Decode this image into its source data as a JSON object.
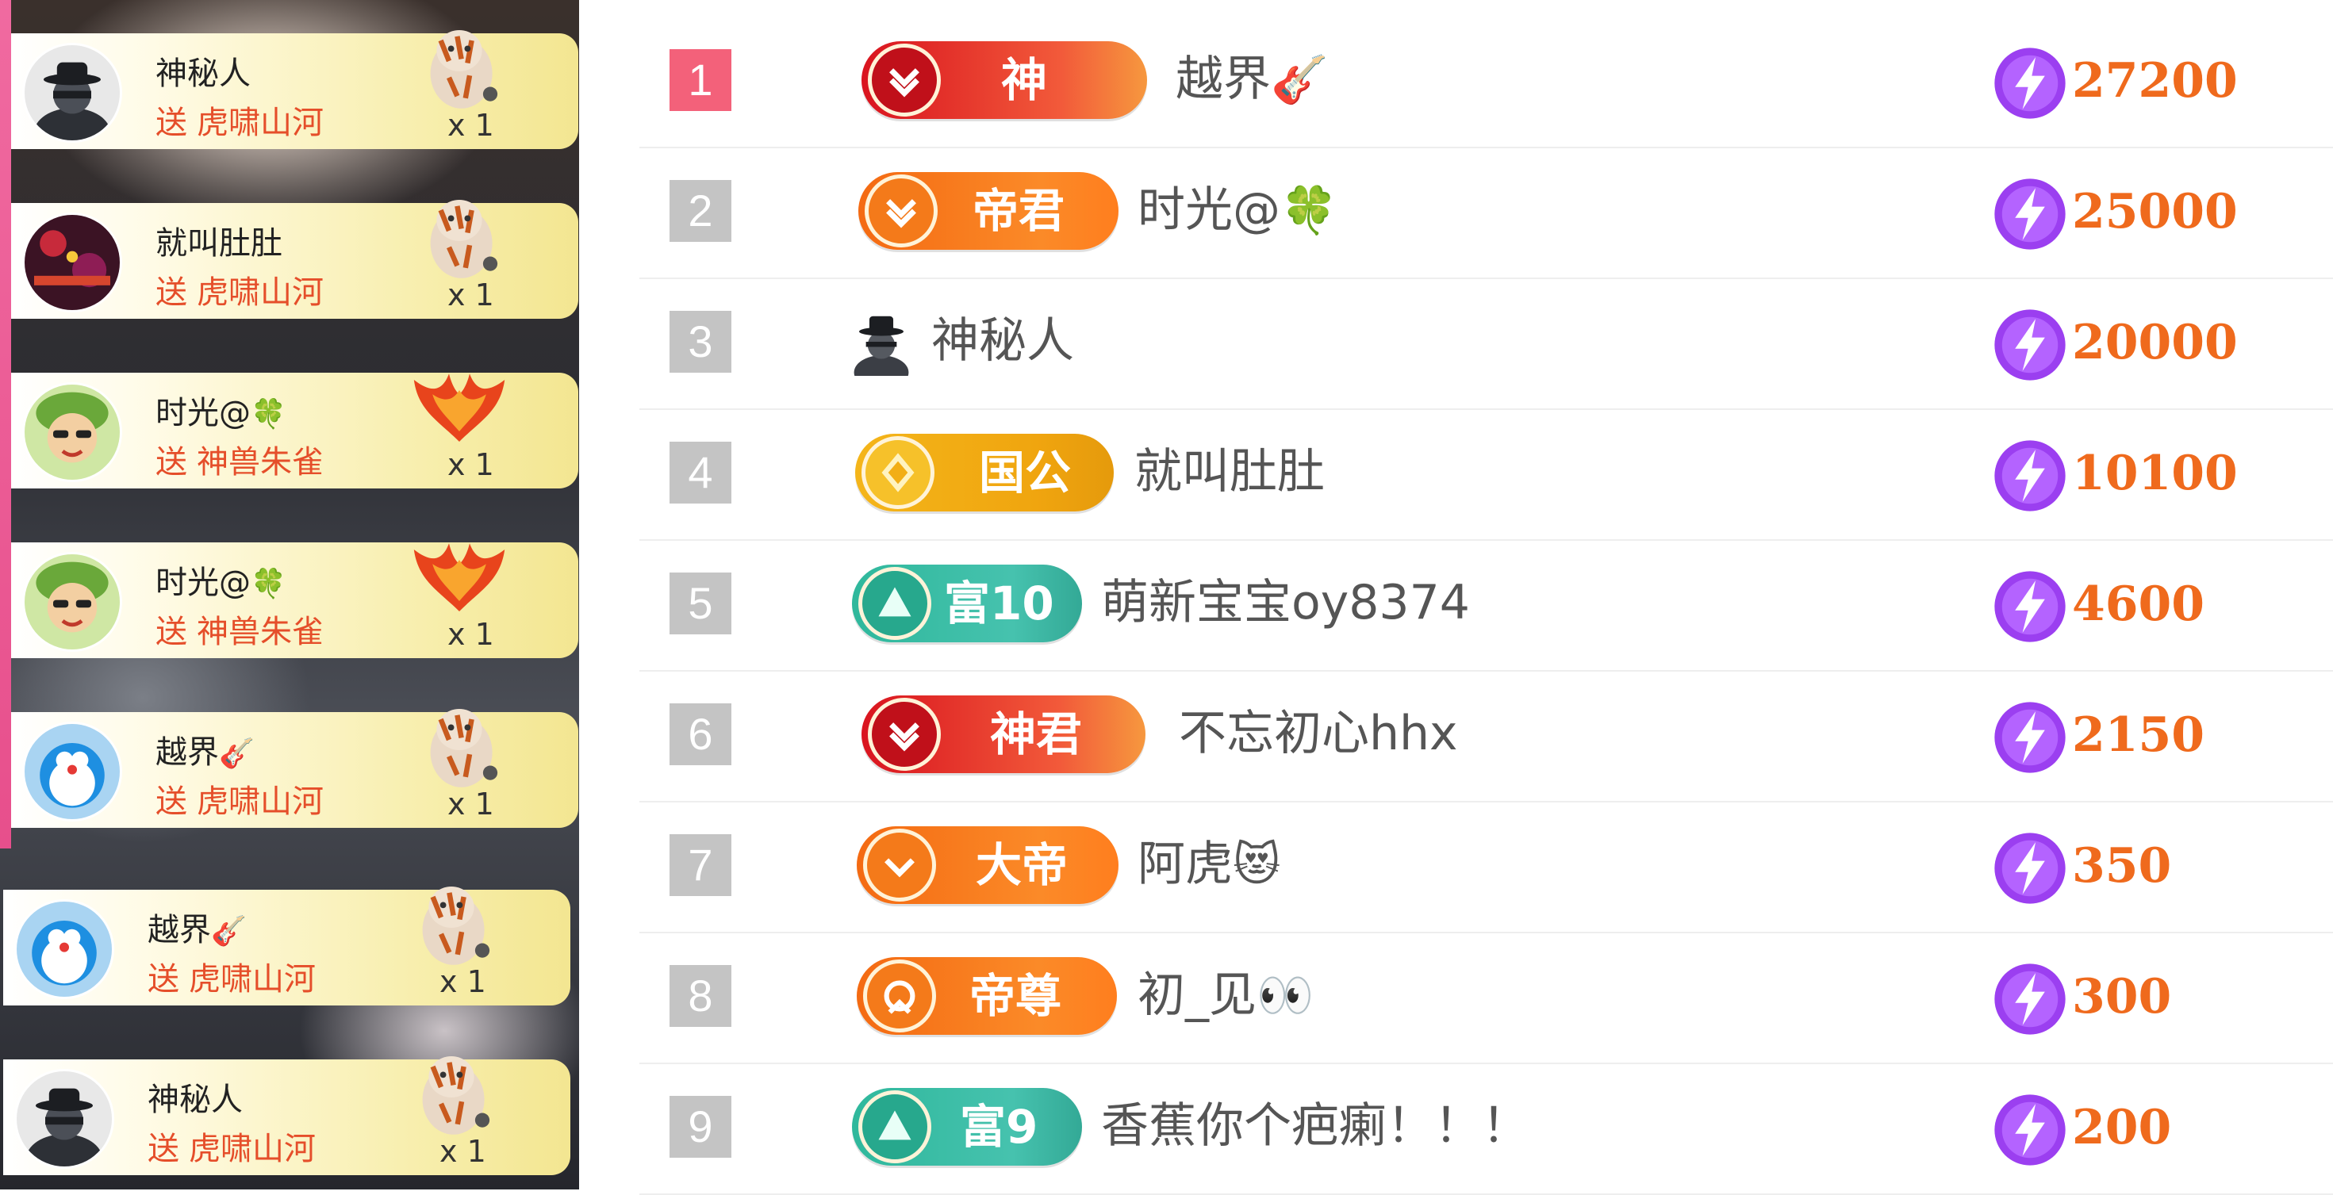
{
  "gift_feed": {
    "items": [
      {
        "sender": "神秘人",
        "sender_emoji": "",
        "verb": "送",
        "gift": "虎啸山河",
        "count": "x 1",
        "avatar": "mystery-avatar",
        "gift_icon": "tiger-gift-icon"
      },
      {
        "sender": "就叫肚肚",
        "sender_emoji": "",
        "verb": "送",
        "gift": "虎啸山河",
        "count": "x 1",
        "avatar": "game-avatar",
        "gift_icon": "tiger-gift-icon"
      },
      {
        "sender": "时光@",
        "sender_emoji": "🍀",
        "verb": "送",
        "gift": "神兽朱雀",
        "count": "x 1",
        "avatar": "cartoon-kid-avatar",
        "gift_icon": "phoenix-gift-icon"
      },
      {
        "sender": "时光@",
        "sender_emoji": "🍀",
        "verb": "送",
        "gift": "神兽朱雀",
        "count": "x 1",
        "avatar": "cartoon-kid-avatar",
        "gift_icon": "phoenix-gift-icon"
      },
      {
        "sender": "越界",
        "sender_emoji": "🎸",
        "verb": "送",
        "gift": "虎啸山河",
        "count": "x 1",
        "avatar": "doraemon-avatar",
        "gift_icon": "tiger-gift-icon"
      },
      {
        "sender": "越界",
        "sender_emoji": "🎸",
        "verb": "送",
        "gift": "虎啸山河",
        "count": "x 1",
        "avatar": "doraemon-avatar",
        "gift_icon": "tiger-gift-icon"
      },
      {
        "sender": "神秘人",
        "sender_emoji": "",
        "verb": "送",
        "gift": "虎啸山河",
        "count": "x 1",
        "avatar": "mystery-avatar",
        "gift_icon": "tiger-gift-icon"
      }
    ]
  },
  "ranking": {
    "score_icon": "lightning-icon",
    "colors": {
      "top_rank": "#f3617a",
      "rank": "#c4c4c4",
      "score": "#ef6a1d"
    },
    "rows": [
      {
        "rank": "1",
        "badge": "神",
        "badge_style": "red",
        "name": "越界",
        "name_emoji": "🎸",
        "score": "27200"
      },
      {
        "rank": "2",
        "badge": "帝君",
        "badge_style": "orange",
        "name": "时光@",
        "name_emoji": "🍀",
        "score": "25000"
      },
      {
        "rank": "3",
        "badge": "",
        "badge_style": "mystery",
        "name": "神秘人",
        "name_emoji": "",
        "score": "20000"
      },
      {
        "rank": "4",
        "badge": "国公",
        "badge_style": "gold",
        "name": "就叫肚肚",
        "name_emoji": "",
        "score": "10100"
      },
      {
        "rank": "5",
        "badge": "富10",
        "badge_style": "teal",
        "name": "萌新宝宝oy8374",
        "name_emoji": "",
        "score": "4600"
      },
      {
        "rank": "6",
        "badge": "神君",
        "badge_style": "red",
        "name": "不忘初心hhx",
        "name_emoji": "",
        "score": "2150"
      },
      {
        "rank": "7",
        "badge": "大帝",
        "badge_style": "orange",
        "name": "阿虎",
        "name_emoji": "😻",
        "score": "350"
      },
      {
        "rank": "8",
        "badge": "帝尊",
        "badge_style": "orange",
        "name": "初_见",
        "name_emoji": "👀",
        "score": "300"
      },
      {
        "rank": "9",
        "badge": "富9",
        "badge_style": "teal",
        "name": "香蕉你个疤瘌！！！",
        "name_emoji": "",
        "score": "200"
      }
    ]
  }
}
